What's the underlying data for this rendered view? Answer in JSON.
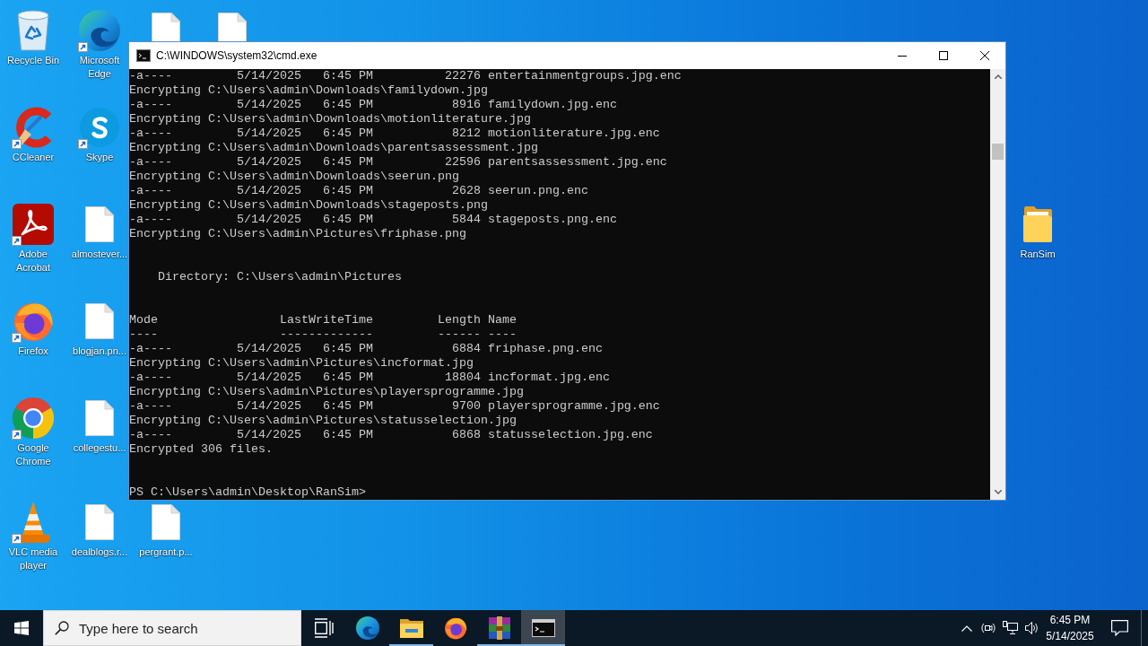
{
  "desktop": {
    "rows": [
      [
        {
          "label": "Recycle Bin",
          "kind": "recyclebin",
          "shortcut": false
        },
        {
          "label": "Microsoft Edge",
          "kind": "edge",
          "shortcut": true
        },
        {
          "kind": "file",
          "shortcut": false
        },
        {
          "kind": "file",
          "shortcut": false
        }
      ],
      [
        {
          "label": "CCleaner",
          "kind": "ccleaner",
          "shortcut": true
        },
        {
          "label": "Skype",
          "kind": "skype",
          "shortcut": true
        }
      ],
      [
        {
          "label": "Adobe Acrobat",
          "kind": "acrobat",
          "shortcut": true
        },
        {
          "label": "almostever...",
          "kind": "file",
          "shortcut": false
        }
      ],
      [
        {
          "label": "Firefox",
          "kind": "firefox",
          "shortcut": true
        },
        {
          "label": "blogjan.pn...",
          "kind": "file",
          "shortcut": false
        }
      ],
      [
        {
          "label": "Google Chrome",
          "kind": "chrome",
          "shortcut": true
        },
        {
          "label": "collegestu...",
          "kind": "file",
          "shortcut": false
        }
      ],
      [
        {
          "label": "VLC media player",
          "kind": "vlc",
          "shortcut": true
        },
        {
          "label": "dealblogs.r...",
          "kind": "file",
          "shortcut": false
        },
        {
          "label": "pergrant.p...",
          "kind": "file",
          "shortcut": false
        }
      ]
    ],
    "right_icons": [
      {
        "label": "RanSim",
        "kind": "folder",
        "shortcut": false
      }
    ]
  },
  "window": {
    "title": "C:\\WINDOWS\\system32\\cmd.exe",
    "console": {
      "blocks": [
        [
          "-a----         5/14/2025   6:45 PM          22276 entertainmentgroups.jpg.enc",
          "Encrypting C:\\Users\\admin\\Downloads\\familydown.jpg",
          "-a----         5/14/2025   6:45 PM           8916 familydown.jpg.enc",
          "Encrypting C:\\Users\\admin\\Downloads\\motionliterature.jpg",
          "-a----         5/14/2025   6:45 PM           8212 motionliterature.jpg.enc",
          "Encrypting C:\\Users\\admin\\Downloads\\parentsassessment.jpg",
          "-a----         5/14/2025   6:45 PM          22596 parentsassessment.jpg.enc",
          "Encrypting C:\\Users\\admin\\Downloads\\seerun.png",
          "-a----         5/14/2025   6:45 PM           2628 seerun.png.enc",
          "Encrypting C:\\Users\\admin\\Downloads\\stageposts.png",
          "-a----         5/14/2025   6:45 PM           5844 stageposts.png.enc",
          "Encrypting C:\\Users\\admin\\Pictures\\friphase.png"
        ],
        [
          "    Directory: C:\\Users\\admin\\Pictures"
        ],
        [
          "Mode                 LastWriteTime         Length Name",
          "----                 -------------         ------ ----",
          "-a----         5/14/2025   6:45 PM           6884 friphase.png.enc",
          "Encrypting C:\\Users\\admin\\Pictures\\incformat.jpg",
          "-a----         5/14/2025   6:45 PM          18804 incformat.jpg.enc",
          "Encrypting C:\\Users\\admin\\Pictures\\playersprogramme.jpg",
          "-a----         5/14/2025   6:45 PM           9700 playersprogramme.jpg.enc",
          "Encrypting C:\\Users\\admin\\Pictures\\statusselection.jpg",
          "-a----         5/14/2025   6:45 PM           6868 statusselection.jpg.enc",
          "Encrypted 306 files."
        ],
        [
          "PS C:\\Users\\admin\\Desktop\\RanSim>"
        ]
      ]
    }
  },
  "taskbar": {
    "search": {
      "placeholder": "Type here to search"
    },
    "apps": [
      {
        "kind": "taskview",
        "running": false,
        "selected": false
      },
      {
        "kind": "edge",
        "running": false,
        "selected": false
      },
      {
        "kind": "explorer",
        "running": true,
        "selected": false
      },
      {
        "kind": "firefox",
        "running": false,
        "selected": false
      },
      {
        "kind": "winrar",
        "running": true,
        "selected": false
      },
      {
        "kind": "cmd",
        "running": true,
        "selected": true
      }
    ],
    "clock": {
      "time": "6:45 PM",
      "date": "5/14/2025"
    }
  }
}
